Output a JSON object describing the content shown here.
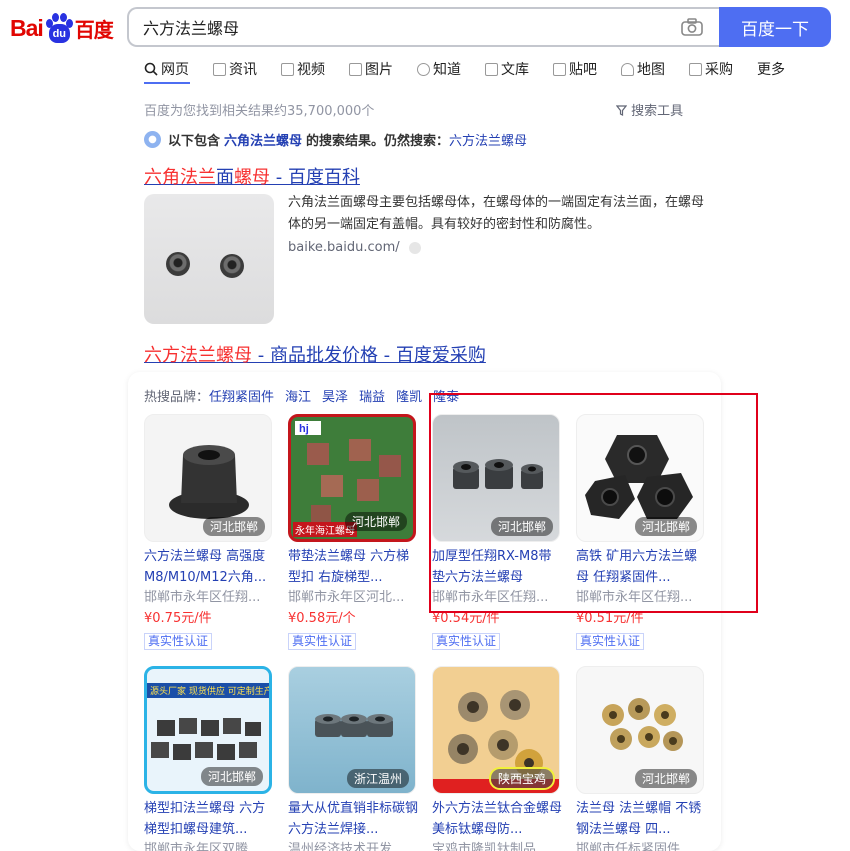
{
  "logo": {
    "latin": "Bai",
    "paw": "du",
    "chinese": "百度"
  },
  "search": {
    "query": "六方法兰螺母",
    "button": "百度一下"
  },
  "tabs": [
    {
      "label": "网页",
      "icon": "search-icon"
    },
    {
      "label": "资讯",
      "icon": "news-icon"
    },
    {
      "label": "视频",
      "icon": "video-icon"
    },
    {
      "label": "图片",
      "icon": "image-icon"
    },
    {
      "label": "知道",
      "icon": "question-icon"
    },
    {
      "label": "文库",
      "icon": "library-icon"
    },
    {
      "label": "贴吧",
      "icon": "tieba-icon"
    },
    {
      "label": "地图",
      "icon": "map-icon"
    },
    {
      "label": "采购",
      "icon": "shop-icon"
    },
    {
      "label": "更多",
      "icon": ""
    }
  ],
  "result_count": "百度为您找到相关结果约35,700,000个",
  "tools": "搜索工具",
  "notice": {
    "prefix": "以下包含",
    "term": "六角法兰螺母",
    "middle": "的搜索结果。仍然搜索：",
    "link": "六方法兰螺母"
  },
  "result1": {
    "title_parts": [
      "六角法兰",
      "面",
      "螺母",
      " - 百度百科"
    ],
    "abstract": "六角法兰面螺母主要包括螺母体，在螺母体的一端固定有法兰面，在螺母体的另一端固定有盖帽。具有较好的密封性和防腐性。",
    "source": "baike.baidu.com/"
  },
  "result2": {
    "title_parts": [
      "六方法兰螺母",
      " - 商品批发价格 - 百度爱采购"
    ]
  },
  "brands": {
    "label": "热搜品牌：",
    "items": [
      "任翔紧固件",
      "海江",
      "昊泽",
      "瑞益",
      "隆凯",
      "隆泰"
    ]
  },
  "products": [
    {
      "name": "六方法兰螺母 高强度M8/M10/M12六角...",
      "seller": "邯郸市永年区任翔...",
      "price": "¥0.75元/件",
      "location": "河北邯郸",
      "badge": "真实性认证"
    },
    {
      "name": "带垫法兰螺母 六方梯型扣 右旋梯型...",
      "seller": "邯郸市永年区河北...",
      "price": "¥0.58元/个",
      "location": "河北邯郸",
      "badge": "真实性认证",
      "overlay": "永年海江螺母"
    },
    {
      "name": "加厚型任翔RX-M8带垫六方法兰螺母",
      "seller": "邯郸市永年区任翔...",
      "price": "¥0.54元/件",
      "location": "河北邯郸",
      "badge": "真实性认证"
    },
    {
      "name": "高铁 矿用六方法兰螺母 任翔紧固件...",
      "seller": "邯郸市永年区任翔...",
      "price": "¥0.51元/件",
      "location": "河北邯郸",
      "badge": "真实性认证"
    },
    {
      "name": "梯型扣法兰螺母 六方梯型扣螺母建筑...",
      "seller": "邯郸市永年区双腾...",
      "location": "河北邯郸",
      "overlay": "源头厂家 现货供应 可定制生产"
    },
    {
      "name": "量大从优直销非标碳钢六方法兰焊接...",
      "seller": "温州经济技术开发...",
      "location": "浙江温州"
    },
    {
      "name": "外六方法兰钛合金螺母 美标钛螺母防...",
      "seller": "宝鸡市隆凯钛制品...",
      "location": "陕西宝鸡"
    },
    {
      "name": "法兰母 法兰螺帽 不锈钢法兰螺母 四...",
      "seller": "邯郸市任标紧固件...",
      "location": "河北邯郸"
    }
  ],
  "colors": {
    "brand_red": "#e10602",
    "brand_blue": "#2932e1",
    "button": "#4e6ef2",
    "link": "#2440b3",
    "highlight": "#f73131",
    "annotation_box": "#e0001b"
  }
}
